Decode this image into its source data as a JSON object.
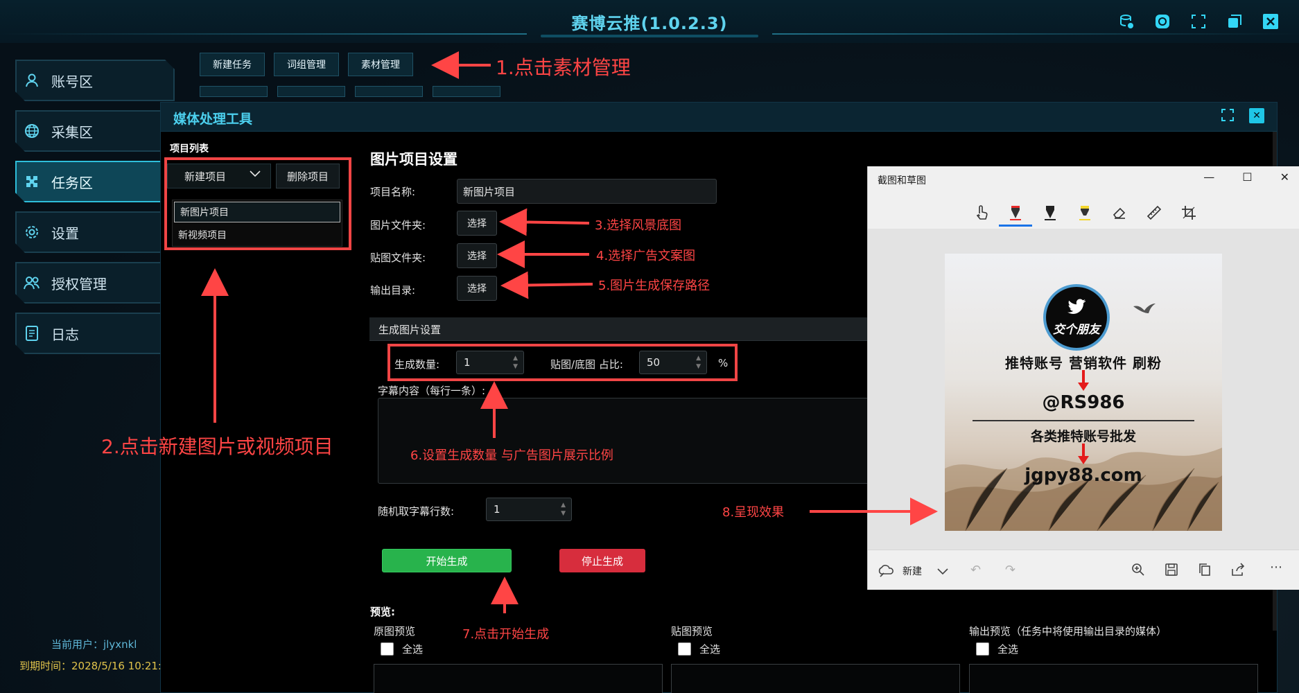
{
  "app": {
    "title": "赛博云推(1.0.2.3)",
    "window_buttons": [
      "database-icon",
      "refresh-icon",
      "fullscreen-icon",
      "restore-icon",
      "close-icon"
    ]
  },
  "sidebar": {
    "items": [
      {
        "label": "账号区",
        "icon": "user-icon",
        "active": false
      },
      {
        "label": "采集区",
        "icon": "globe-icon",
        "active": false
      },
      {
        "label": "任务区",
        "icon": "puzzle-icon",
        "active": true
      },
      {
        "label": "设置",
        "icon": "gear-icon",
        "active": false
      },
      {
        "label": "授权管理",
        "icon": "users-icon",
        "active": false
      },
      {
        "label": "日志",
        "icon": "document-icon",
        "active": false
      }
    ],
    "current_user": "当前用户：jlyxnkl",
    "expire_time": "到期时间：2028/5/16 10:21:"
  },
  "top_tabs": [
    "新建任务",
    "词组管理",
    "素材管理"
  ],
  "dialog": {
    "title": "媒体处理工具",
    "project_list": {
      "label": "项目列表",
      "new_button": "新建项目",
      "delete_button": "删除项目",
      "items": [
        "新图片项目",
        "新视频项目"
      ],
      "selected_index": 0
    },
    "settings": {
      "title": "图片项目设置",
      "name_label": "项目名称:",
      "name_value": "新图片项目",
      "image_folder_label": "图片文件夹:",
      "sticker_folder_label": "贴图文件夹:",
      "output_dir_label": "输出目录:",
      "choose_label": "选择"
    },
    "generate": {
      "panel_title": "生成图片设置",
      "count_label": "生成数量:",
      "count_value": "1",
      "ratio_label": "贴图/底图 占比:",
      "ratio_value": "50",
      "ratio_unit": "%",
      "caption_label": "字幕内容（每行一条）:",
      "caption_value": "",
      "random_lines_label": "随机取字幕行数:",
      "random_lines_value": "1",
      "start_button": "开始生成",
      "stop_button": "停止生成"
    },
    "preview": {
      "label": "预览:",
      "columns": [
        {
          "label": "原图预览",
          "select_all": "全选"
        },
        {
          "label": "贴图预览",
          "select_all": "全选"
        },
        {
          "label": "输出预览（任务中将使用输出目录的媒体）",
          "select_all": "全选"
        }
      ]
    }
  },
  "snip_window": {
    "title": "截图和草图",
    "tools": [
      "touch-writing-icon",
      "ballpoint-pen-icon",
      "pencil-icon",
      "highlighter-icon",
      "eraser-icon",
      "ruler-icon",
      "crop-icon"
    ],
    "new_label": "新建",
    "bottom_tools": [
      "zoom-icon",
      "save-icon",
      "copy-icon",
      "share-icon",
      "more-icon"
    ],
    "ad_image": {
      "logo_text": "交个朋友",
      "line1": "推特账号 营销软件 刷粉",
      "handle": "@RS986",
      "line2": "各类推特账号批发",
      "url": "jgpy88.com"
    }
  },
  "annotations": {
    "a1": "1.点击素材管理",
    "a2": "2.点击新建图片或视频项目",
    "a3": "3.选择风景底图",
    "a4": "4.选择广告文案图",
    "a5": "5.图片生成保存路径",
    "a6": "6.设置生成数量 与广告图片展示比例",
    "a7": "7.点击开始生成",
    "a8": "8.呈现效果"
  },
  "colors": {
    "accent": "#33d6f5",
    "annotation": "#ff4545",
    "start": "#28b34c",
    "stop": "#d72d3d"
  }
}
